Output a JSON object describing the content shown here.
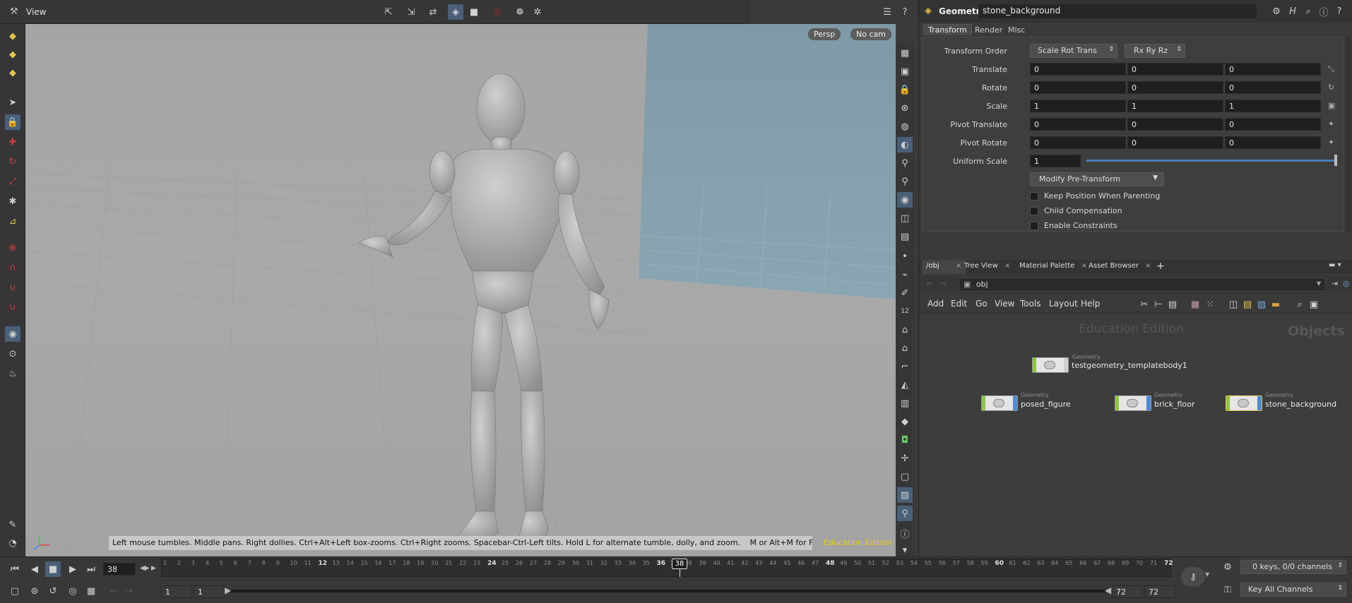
{
  "viewer": {
    "title": "View",
    "persp_label": "Persp",
    "cam_label": "No cam",
    "status_text": "Left mouse tumbles. Middle pans. Right dollies. Ctrl+Alt+Left box-zooms. Ctrl+Right zooms. Spacebar-Ctrl-Left tilts. Hold L for alternate tumble, dolly, and zoom.",
    "status_text2": "M or Alt+M for First Person Navigation.",
    "edition": "Education Edition"
  },
  "params": {
    "node_type": "Geometry",
    "node_name": "stone_background",
    "tabs": [
      "Transform",
      "Render",
      "Misc"
    ],
    "transform_order_label": "Transform Order",
    "transform_order_value": "Scale Rot Trans",
    "rotate_order_value": "Rx Ry Rz",
    "rows": [
      {
        "label": "Translate",
        "values": [
          "0",
          "0",
          "0"
        ]
      },
      {
        "label": "Rotate",
        "values": [
          "0",
          "0",
          "0"
        ]
      },
      {
        "label": "Scale",
        "values": [
          "1",
          "1",
          "1"
        ]
      },
      {
        "label": "Pivot Translate",
        "values": [
          "0",
          "0",
          "0"
        ]
      },
      {
        "label": "Pivot Rotate",
        "values": [
          "0",
          "0",
          "0"
        ]
      }
    ],
    "uniform_scale_label": "Uniform Scale",
    "uniform_scale_value": "1",
    "modify_button": "Modify Pre-Transform",
    "checkboxes": [
      "Keep Position When Parenting",
      "Child Compensation",
      "Enable Constraints"
    ]
  },
  "network": {
    "tabs": [
      "/obj",
      "Tree View",
      "Material Palette",
      "Asset Browser"
    ],
    "path": "obj",
    "menu": [
      "Add",
      "Edit",
      "Go",
      "View",
      "Tools",
      "Layout",
      "Help"
    ],
    "watermark": "Education Edition",
    "context_label": "Objects",
    "nodes": [
      {
        "type": "Geometry",
        "name": "testgeometry_templatebody1"
      },
      {
        "type": "Geometry",
        "name": "posed_figure"
      },
      {
        "type": "Geometry",
        "name": "brick_floor"
      },
      {
        "type": "Geometry",
        "name": "stone_background"
      }
    ]
  },
  "timeline": {
    "current_frame": "38",
    "frame_marker": "38",
    "start": "1",
    "start2": "1",
    "end": "72",
    "end2": "72",
    "ticks": [
      "1",
      "2",
      "3",
      "4",
      "5",
      "6",
      "7",
      "8",
      "9",
      "10",
      "11",
      "12",
      "13",
      "14",
      "15",
      "16",
      "17",
      "18",
      "19",
      "20",
      "21",
      "22",
      "23",
      "24",
      "25",
      "26",
      "27",
      "28",
      "29",
      "30",
      "31",
      "32",
      "33",
      "34",
      "35",
      "36",
      "37",
      "38",
      "39",
      "40",
      "41",
      "42",
      "43",
      "44",
      "45",
      "46",
      "47",
      "48",
      "49",
      "50",
      "51",
      "52",
      "53",
      "54",
      "55",
      "56",
      "57",
      "58",
      "59",
      "60",
      "61",
      "62",
      "63",
      "64",
      "65",
      "66",
      "67",
      "68",
      "69",
      "70",
      "71",
      "72"
    ],
    "keys_info": "0 keys, 0/0 channels",
    "key_all": "Key All Channels"
  }
}
